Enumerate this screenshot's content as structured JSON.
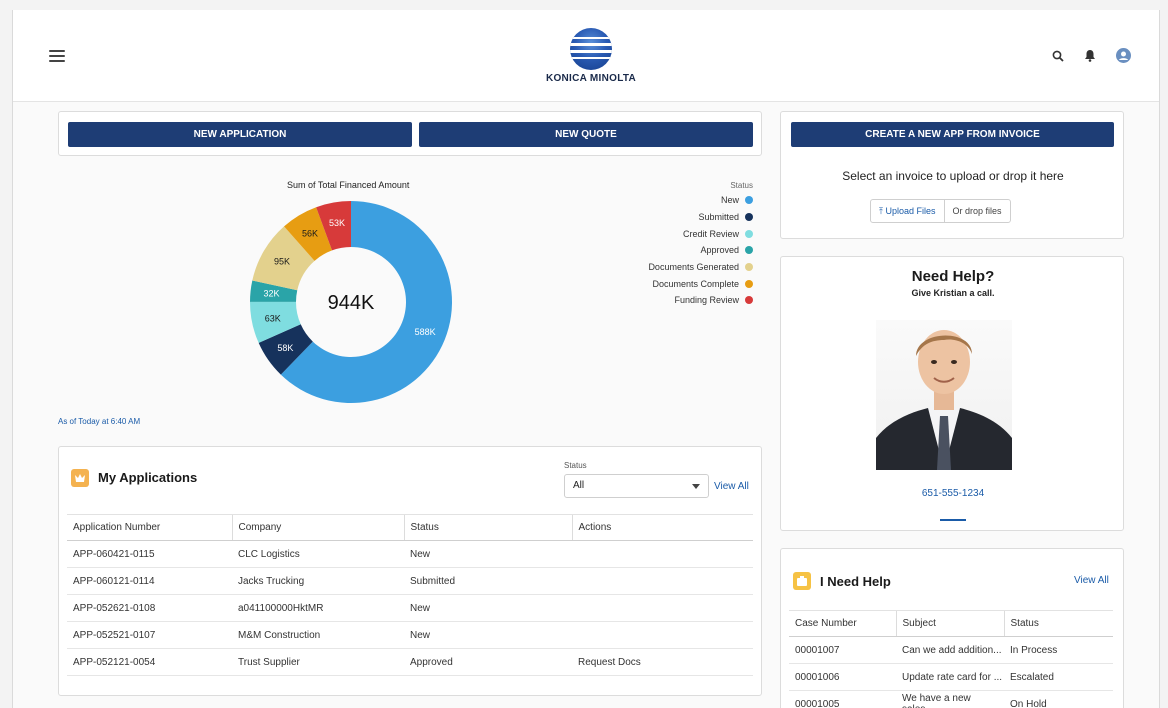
{
  "header": {
    "brand": "KONICA MINOLTA",
    "menu_icon": "hamburger-icon",
    "icons": [
      "search-icon",
      "bell-icon",
      "user-avatar-icon"
    ]
  },
  "actions": {
    "new_application": "NEW APPLICATION",
    "new_quote": "NEW QUOTE"
  },
  "chart_data": {
    "type": "donut",
    "title": "Sum of Total Financed Amount",
    "center_label": "944K",
    "legend_title": "Status",
    "legend_position": "right",
    "series": [
      {
        "name": "New",
        "value": 588,
        "label": "588K",
        "color": "#3c9fe0"
      },
      {
        "name": "Submitted",
        "value": 58,
        "label": "58K",
        "color": "#16325c"
      },
      {
        "name": "Credit Review",
        "value": 63,
        "label": "63K",
        "color": "#7fdde0"
      },
      {
        "name": "Approved",
        "value": 32,
        "label": "32K",
        "color": "#2aa4a8"
      },
      {
        "name": "Documents Generated",
        "value": 95,
        "label": "95K",
        "color": "#e3d18d"
      },
      {
        "name": "Documents Complete",
        "value": 56,
        "label": "56K",
        "color": "#e79d12"
      },
      {
        "name": "Funding Review",
        "value": 53,
        "label": "53K",
        "color": "#d73a3a"
      }
    ],
    "unit": "K"
  },
  "asof": "As of Today at 6:40 AM",
  "my_apps": {
    "title": "My Applications",
    "status_label": "Status",
    "status_value": "All",
    "view_all": "View All",
    "columns": [
      "Application Number",
      "Company",
      "Status",
      "Actions"
    ],
    "rows": [
      {
        "number": "APP-060421-0115",
        "company": "CLC Logistics",
        "status": "New",
        "action": ""
      },
      {
        "number": "APP-060121-0114",
        "company": "Jacks Trucking",
        "status": "Submitted",
        "action": ""
      },
      {
        "number": "APP-052621-0108",
        "company": "a041100000HktMR",
        "status": "New",
        "action": ""
      },
      {
        "number": "APP-052521-0107",
        "company": "M&M Construction",
        "status": "New",
        "action": ""
      },
      {
        "number": "APP-052121-0054",
        "company": "Trust Supplier",
        "status": "Approved",
        "action": "Request Docs"
      }
    ]
  },
  "invoice": {
    "button": "CREATE A NEW APP FROM INVOICE",
    "prompt": "Select an invoice to upload or drop it here",
    "upload_label": "Upload Files",
    "drop_label": "Or drop files"
  },
  "help": {
    "title": "Need Help?",
    "subtitle": "Give Kristian a call.",
    "phone": "651-555-1234"
  },
  "ineed": {
    "title": "I Need Help",
    "view_all": "View All",
    "columns": [
      "Case Number",
      "Subject",
      "Status"
    ],
    "rows": [
      {
        "case": "00001007",
        "subject": "Can we add addition...",
        "status": "In Process"
      },
      {
        "case": "00001006",
        "subject": "Update rate card for ...",
        "status": "Escalated"
      },
      {
        "case": "00001005",
        "subject": "We have a new sales...",
        "status": "On Hold"
      }
    ]
  }
}
